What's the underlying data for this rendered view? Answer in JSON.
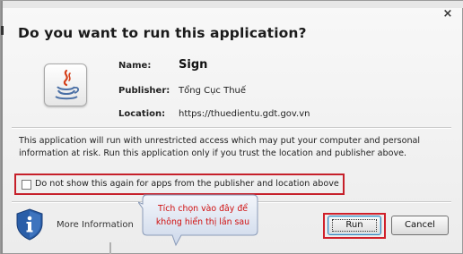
{
  "dialog": {
    "title": "Do you want to run this application?",
    "close_glyph": "×"
  },
  "app_info": {
    "name_label": "Name:",
    "name_value": "Sign",
    "publisher_label": "Publisher:",
    "publisher_value": "Tổng Cục Thuế",
    "location_label": "Location:",
    "location_value": "https://thuedientu.gdt.gov.vn"
  },
  "message": "This application will run with unrestricted access which may put your computer and personal information at risk. Run this application only if you trust the location and publisher above.",
  "checkbox": {
    "label": "Do not show this again for apps from the publisher and location above",
    "checked": false
  },
  "more_info_label": "More Information",
  "annotation": {
    "line1": "Tích chọn vào đây để",
    "line2": "không hiển thị lần sau",
    "color": "#d01010"
  },
  "buttons": {
    "run_label": "Run",
    "cancel_label": "Cancel"
  },
  "colors": {
    "highlight": "#c6202a",
    "shield": "#2a5ea8"
  },
  "icons": [
    "java-icon",
    "shield-info-icon",
    "close-icon"
  ]
}
